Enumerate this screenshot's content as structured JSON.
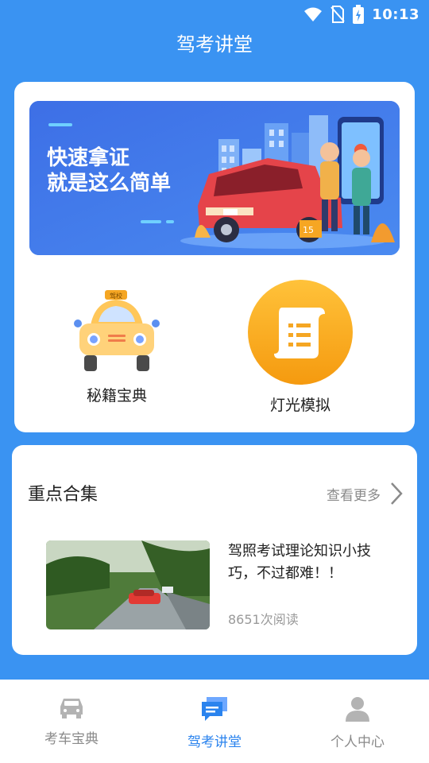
{
  "status_bar": {
    "time": "10:13"
  },
  "header": {
    "title": "驾考讲堂"
  },
  "banner": {
    "line1": "快速拿证",
    "line2": "就是这么简单",
    "badge": "15"
  },
  "features": [
    {
      "label": "秘籍宝典",
      "icon": "taxi-icon",
      "sign": "驾校"
    },
    {
      "label": "灯光模拟",
      "icon": "scroll-icon"
    }
  ],
  "section": {
    "title": "重点合集",
    "more_label": "查看更多",
    "article": {
      "title": "驾照考试理论知识小技巧，不过都难！！",
      "reads": "8651次阅读"
    }
  },
  "bottom_nav": [
    {
      "label": "考车宝典",
      "icon": "car-icon",
      "active": false
    },
    {
      "label": "驾考讲堂",
      "icon": "chat-icon",
      "active": true
    },
    {
      "label": "个人中心",
      "icon": "person-icon",
      "active": false
    }
  ],
  "colors": {
    "primary": "#3a93f2",
    "active": "#2a83ee",
    "accent_orange": "#f6a623"
  }
}
